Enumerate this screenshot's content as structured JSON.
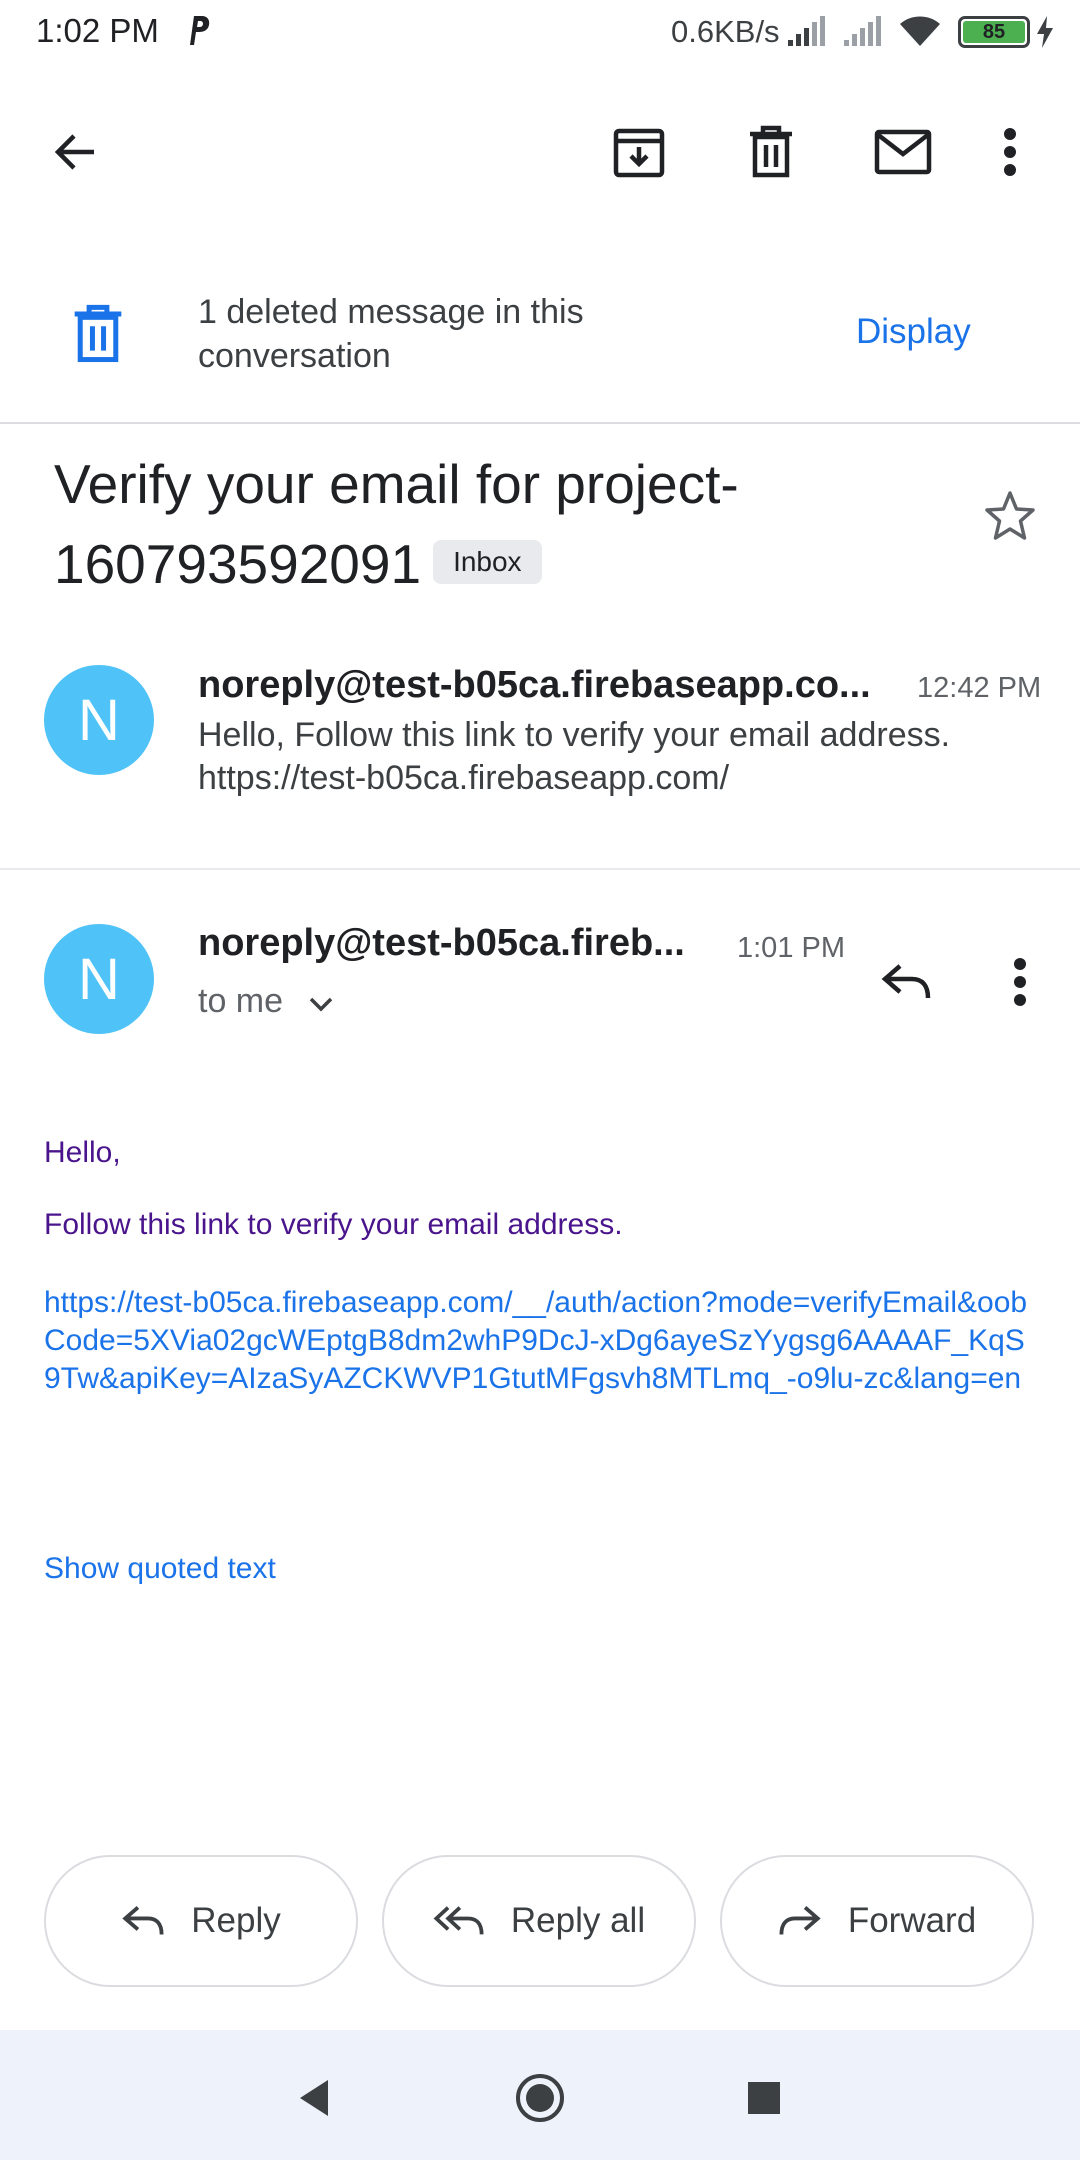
{
  "status_bar": {
    "time": "1:02 PM",
    "network_speed": "0.6KB/s",
    "battery": "85"
  },
  "toolbar": {
    "back_icon": "arrow-left",
    "archive_icon": "archive",
    "delete_icon": "trash",
    "mark_unread_icon": "mail",
    "more_icon": "more-vertical"
  },
  "deleted_banner": {
    "text": "1 deleted message in this conversation",
    "action": "Display"
  },
  "thread": {
    "subject": "Verify your email for project-160793592091",
    "label": "Inbox"
  },
  "messages": [
    {
      "avatar_letter": "N",
      "sender": "noreply@test-b05ca.firebaseapp.co...",
      "time": "12:42 PM",
      "snippet": "Hello, Follow this link to verify your email address. https://test-b05ca.firebaseapp.com/"
    },
    {
      "avatar_letter": "N",
      "sender": "noreply@test-b05ca.fireb...",
      "time": "1:01 PM",
      "recipient": "to me",
      "greeting": "Hello,",
      "instruction": "Follow this link to verify your email address.",
      "link": "https://test-b05ca.firebaseapp.com/__/auth/action?mode=verifyEmail&oobCode=5XVia02gcWEptgB8dm2whP9DcJ-xDg6ayeSzYygsg6AAAAF_KqS9Tw&apiKey=AIzaSyAZCKWVP1GtutMFgsvh8MTLmq_-o9lu-zc&lang=en",
      "show_quoted": "Show quoted text"
    }
  ],
  "actions": {
    "reply": "Reply",
    "reply_all": "Reply all",
    "forward": "Forward"
  },
  "colors": {
    "accent": "#1a73e8",
    "avatar": "#4fc3f7",
    "body_text": "#4a148c"
  }
}
